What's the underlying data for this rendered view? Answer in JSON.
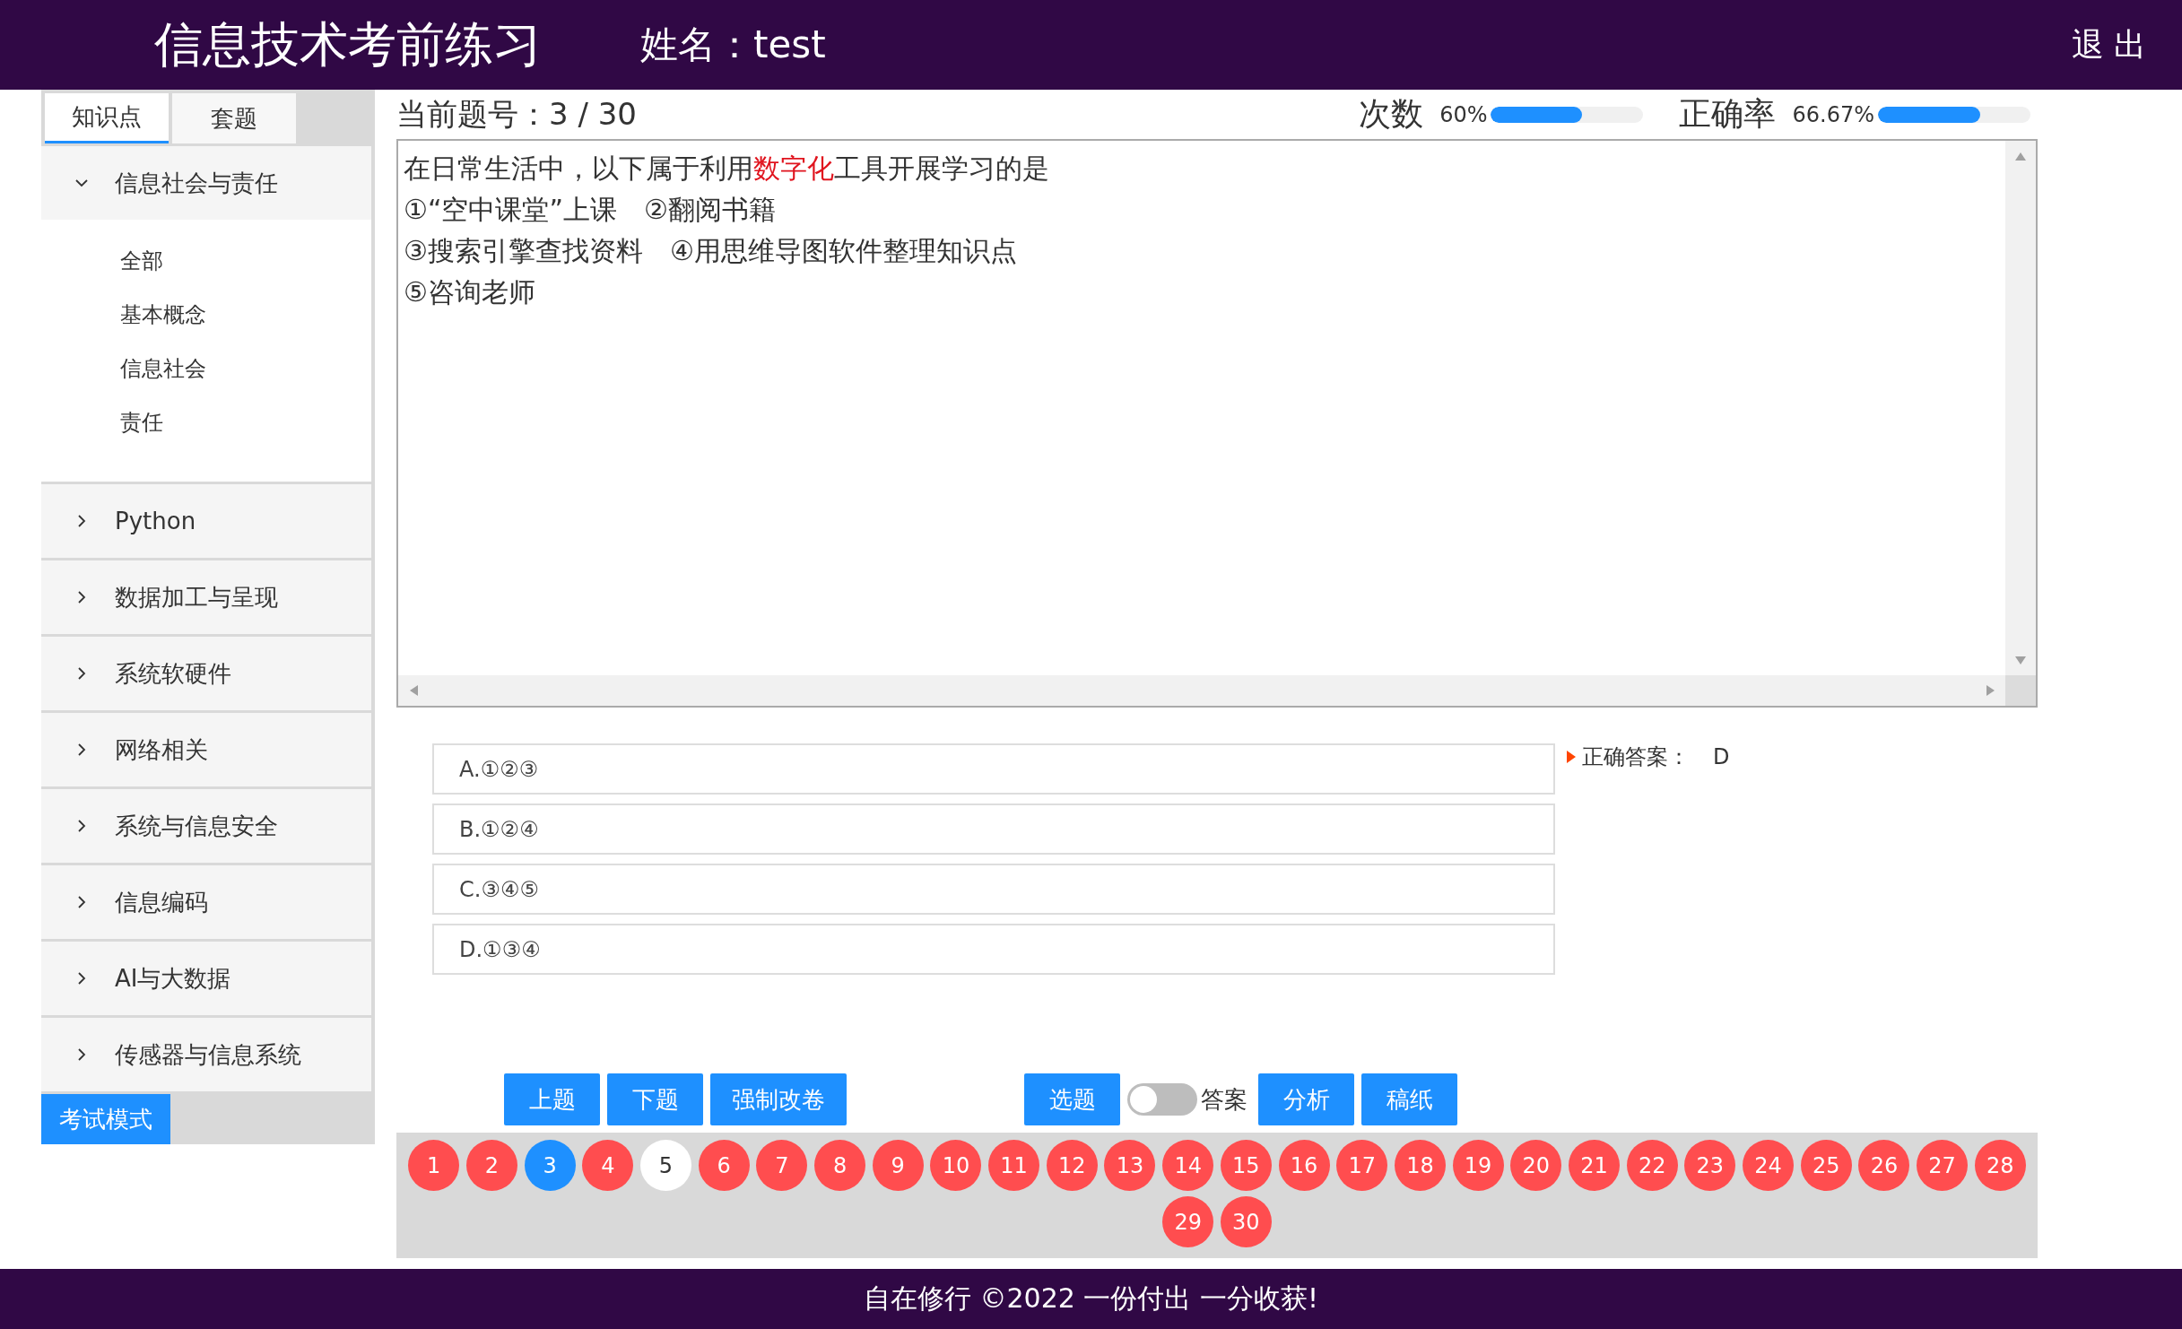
{
  "header": {
    "title": "信息技术考前练习",
    "user_label": "姓名：",
    "user_name": "test",
    "logout": "退 出"
  },
  "sidebar": {
    "tabs": [
      {
        "label": "知识点",
        "selected": true
      },
      {
        "label": "套题",
        "selected": false
      }
    ],
    "categories": [
      {
        "label": "信息社会与责任",
        "expanded": true,
        "children": [
          {
            "label": "全部"
          },
          {
            "label": "基本概念"
          },
          {
            "label": "信息社会"
          },
          {
            "label": "责任"
          }
        ]
      },
      {
        "label": "Python",
        "expanded": false
      },
      {
        "label": "数据加工与呈现",
        "expanded": false
      },
      {
        "label": "系统软硬件",
        "expanded": false
      },
      {
        "label": "网络相关",
        "expanded": false
      },
      {
        "label": "系统与信息安全",
        "expanded": false
      },
      {
        "label": "信息编码",
        "expanded": false
      },
      {
        "label": "AI与大数据",
        "expanded": false
      },
      {
        "label": "传感器与信息系统",
        "expanded": false
      }
    ],
    "mode_button": "考试模式"
  },
  "status": {
    "current_question": "当前题号：3 / 30",
    "meters": [
      {
        "label": "次数",
        "reading": "60%",
        "level": 0.6
      },
      {
        "label": "正确率",
        "reading": "66.67%",
        "level": 0.67
      }
    ]
  },
  "question": {
    "lines": [
      "在日常生活中，以下属于利用**数字化**工具开展学习的是",
      "①“空中课堂”上课　②翻阅书籍",
      "③搜索引擎查找资料　④用思维导图软件整理知识点",
      "⑤咨询老师"
    ]
  },
  "options": [
    {
      "label": "A.①②③"
    },
    {
      "label": "B.①②④"
    },
    {
      "label": "C.③④⑤"
    },
    {
      "label": "D.①③④"
    }
  ],
  "answer": {
    "label": "正确答案：",
    "value": "D"
  },
  "buttons": {
    "left": [
      "上题",
      "下题",
      "强制改卷"
    ],
    "right_first": "选题",
    "answer_toggle": {
      "label": "答案",
      "on": false
    },
    "right": [
      "分析",
      "稿纸"
    ]
  },
  "question_numbers": [
    {
      "label": "1",
      "color": "#ff4d4f"
    },
    {
      "label": "2",
      "color": "#ff4d4f"
    },
    {
      "label": "3",
      "color": "#1e90ff"
    },
    {
      "label": "4",
      "color": "#ff4d4f"
    },
    {
      "label": "5",
      "color": "#ffffff"
    },
    {
      "label": "6",
      "color": "#ff4d4f"
    },
    {
      "label": "7",
      "color": "#ff4d4f"
    },
    {
      "label": "8",
      "color": "#ff4d4f"
    },
    {
      "label": "9",
      "color": "#ff4d4f"
    },
    {
      "label": "10",
      "color": "#ff4d4f"
    },
    {
      "label": "11",
      "color": "#ff4d4f"
    },
    {
      "label": "12",
      "color": "#ff4d4f"
    },
    {
      "label": "13",
      "color": "#ff4d4f"
    },
    {
      "label": "14",
      "color": "#ff4d4f"
    },
    {
      "label": "15",
      "color": "#ff4d4f"
    },
    {
      "label": "16",
      "color": "#ff4d4f"
    },
    {
      "label": "17",
      "color": "#ff4d4f"
    },
    {
      "label": "18",
      "color": "#ff4d4f"
    },
    {
      "label": "19",
      "color": "#ff4d4f"
    },
    {
      "label": "20",
      "color": "#ff4d4f"
    },
    {
      "label": "21",
      "color": "#ff4d4f"
    },
    {
      "label": "22",
      "color": "#ff4d4f"
    },
    {
      "label": "23",
      "color": "#ff4d4f"
    },
    {
      "label": "24",
      "color": "#ff4d4f"
    },
    {
      "label": "25",
      "color": "#ff4d4f"
    },
    {
      "label": "26",
      "color": "#ff4d4f"
    },
    {
      "label": "27",
      "color": "#ff4d4f"
    },
    {
      "label": "28",
      "color": "#ff4d4f"
    },
    {
      "label": "29",
      "color": "#ff4d4f"
    },
    {
      "label": "30",
      "color": "#ff4d4f"
    }
  ],
  "footer": "自在修行 ©2022 一份付出 一分收获!"
}
